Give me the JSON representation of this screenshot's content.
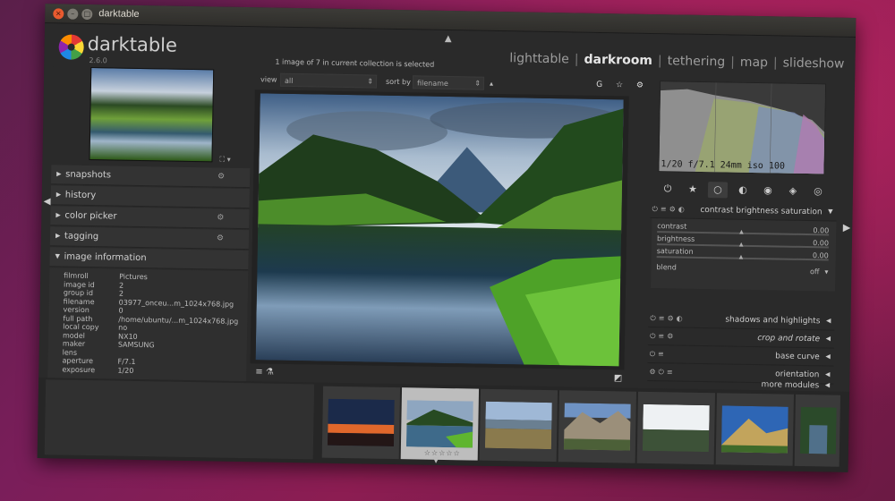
{
  "window": {
    "title": "darktable",
    "close_glyph": "×",
    "min_glyph": "–",
    "max_glyph": "□"
  },
  "header": {
    "app_name": "darktable",
    "version": "2.6.0",
    "collection_status": "1 image of 7 in current collection is selected",
    "views": [
      {
        "label": "lighttable",
        "active": false
      },
      {
        "label": "darkroom",
        "active": true
      },
      {
        "label": "tethering",
        "active": false
      },
      {
        "label": "map",
        "active": false
      },
      {
        "label": "slideshow",
        "active": false
      }
    ],
    "separator": "|"
  },
  "left_panel": {
    "zoom_control": "⛶ ▾",
    "modules": [
      {
        "label": "snapshots",
        "icon": "gear-icon",
        "expanded": false
      },
      {
        "label": "history",
        "icon": "",
        "expanded": false
      },
      {
        "label": "color picker",
        "icon": "gear-icon",
        "expanded": false
      },
      {
        "label": "tagging",
        "icon": "gear-icon",
        "expanded": false
      },
      {
        "label": "image information",
        "icon": "",
        "expanded": true
      }
    ],
    "image_information": [
      {
        "key": "filmroll",
        "value": "Pictures"
      },
      {
        "key": "image id",
        "value": "2"
      },
      {
        "key": "group id",
        "value": "2"
      },
      {
        "key": "filename",
        "value": "03977_onceu...m_1024x768.jpg"
      },
      {
        "key": "version",
        "value": "0"
      },
      {
        "key": "full path",
        "value": "/home/ubuntu/...m_1024x768.jpg"
      },
      {
        "key": "local copy",
        "value": "no"
      },
      {
        "key": "model",
        "value": "NX10"
      },
      {
        "key": "maker",
        "value": "SAMSUNG"
      },
      {
        "key": "lens",
        "value": ""
      },
      {
        "key": "aperture",
        "value": "F/7.1"
      },
      {
        "key": "exposure",
        "value": "1/20"
      }
    ]
  },
  "center": {
    "view_label": "view",
    "view_value": "all",
    "sort_label": "sort by",
    "sort_value": "filename",
    "sort_direction": "▴",
    "top_icons": "G ☆ ⚙",
    "bottom_left_icons": "≡  ⚗",
    "bottom_right_icon": "◩"
  },
  "right_panel": {
    "exif_summary": "1/20 f/7.1 24mm iso 100",
    "group_tabs": [
      "⏻",
      "★",
      "○",
      "◐",
      "◉",
      "◈",
      "◎"
    ],
    "active_tab": 2,
    "modules": [
      {
        "name": "contrast brightness saturation",
        "expanded": true
      },
      {
        "name": "shadows and highlights",
        "expanded": false
      },
      {
        "name": "crop and rotate",
        "expanded": false
      },
      {
        "name": "base curve",
        "expanded": false
      },
      {
        "name": "orientation",
        "expanded": false
      },
      {
        "name": "more modules",
        "expanded": false
      }
    ],
    "sliders": [
      {
        "name": "contrast",
        "value": "0.00"
      },
      {
        "name": "brightness",
        "value": "0.00"
      },
      {
        "name": "saturation",
        "value": "0.00"
      }
    ],
    "blend": {
      "label": "blend",
      "value": "off"
    }
  },
  "filmstrip": {
    "selected_index": 1,
    "stars": "☆☆☆☆☆",
    "thumbs": [
      {
        "name": "night-sky-sunset"
      },
      {
        "name": "mountain-lake"
      },
      {
        "name": "field-mountains"
      },
      {
        "name": "rocky-mountains"
      },
      {
        "name": "winter-forest"
      },
      {
        "name": "alpine-peaks"
      },
      {
        "name": "river-valley"
      }
    ]
  },
  "colors": {
    "accent": "#e6e6e6",
    "panel": "#2a2a2a",
    "ubuntu_close": "#e95a2f"
  }
}
